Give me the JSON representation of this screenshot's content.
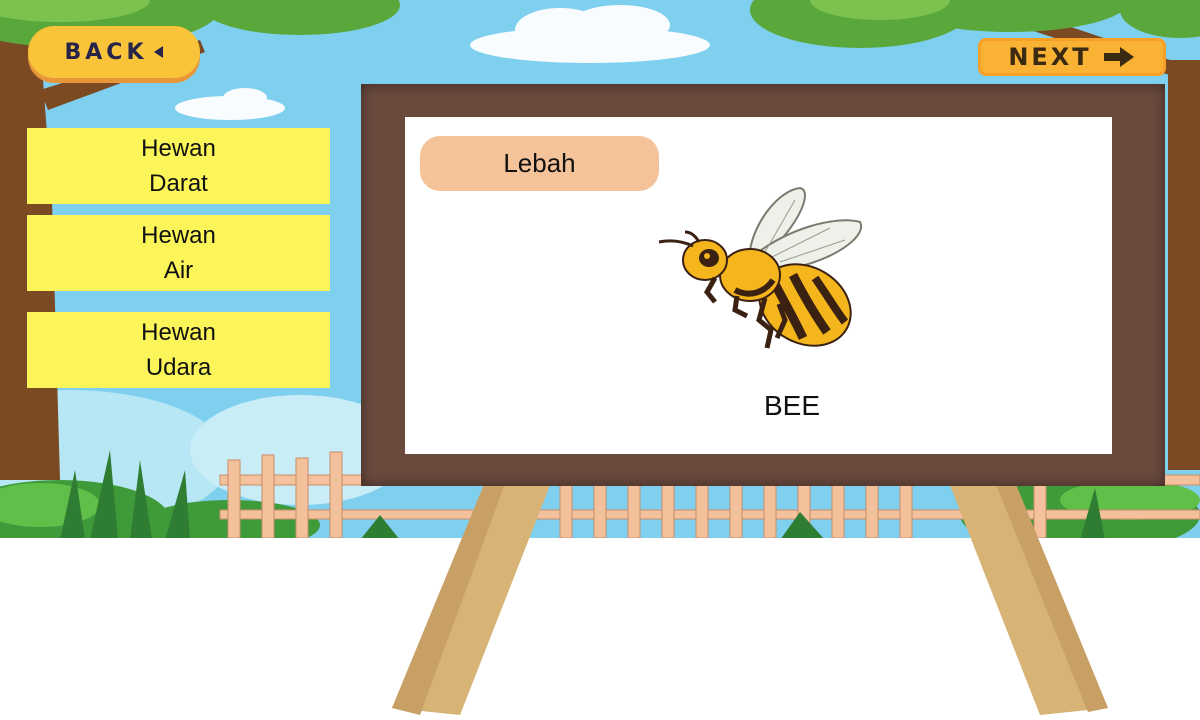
{
  "navigation": {
    "back_label": "BACK",
    "next_label": "NEXT"
  },
  "categories": [
    {
      "line1": "Hewan",
      "line2": "Darat"
    },
    {
      "line1": "Hewan",
      "line2": "Air"
    },
    {
      "line1": "Hewan",
      "line2": "Udara"
    }
  ],
  "card": {
    "local_name": "Lebah",
    "english_name": "BEE",
    "image_icon": "bee-illustration"
  },
  "colors": {
    "sky": "#7fd0ef",
    "button_yellow": "#f9c33a",
    "category_yellow": "#fbf55a",
    "board_brown": "#6b4a3e",
    "pill_peach": "#f5c39a"
  }
}
